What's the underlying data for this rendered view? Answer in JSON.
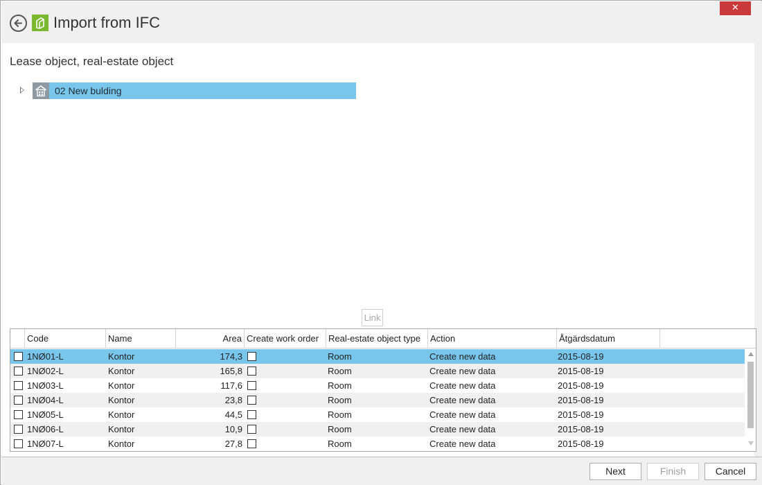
{
  "window": {
    "title": "Import from IFC",
    "close_label": "✕"
  },
  "section": {
    "title": "Lease object, real-estate object"
  },
  "tree": {
    "items": [
      {
        "label": "02 New bulding",
        "icon": "building-icon",
        "selected": true
      }
    ]
  },
  "link_button": {
    "label": "Link"
  },
  "grid": {
    "columns": [
      "Code",
      "Name",
      "Area",
      "Create work order",
      "Real-estate object type",
      "Action",
      "Åtgärdsdatum"
    ],
    "rows": [
      {
        "code": "1NØ01-L",
        "name": "Kontor",
        "area": "174,3",
        "type": "Room",
        "action": "Create new data",
        "date": "2015-08-19"
      },
      {
        "code": "1NØ02-L",
        "name": "Kontor",
        "area": "165,8",
        "type": "Room",
        "action": "Create new data",
        "date": "2015-08-19"
      },
      {
        "code": "1NØ03-L",
        "name": "Kontor",
        "area": "117,6",
        "type": "Room",
        "action": "Create new data",
        "date": "2015-08-19"
      },
      {
        "code": "1NØ04-L",
        "name": "Kontor",
        "area": "23,8",
        "type": "Room",
        "action": "Create new data",
        "date": "2015-08-19"
      },
      {
        "code": "1NØ05-L",
        "name": "Kontor",
        "area": "44,5",
        "type": "Room",
        "action": "Create new data",
        "date": "2015-08-19"
      },
      {
        "code": "1NØ06-L",
        "name": "Kontor",
        "area": "10,9",
        "type": "Room",
        "action": "Create new data",
        "date": "2015-08-19"
      },
      {
        "code": "1NØ07-L",
        "name": "Kontor",
        "area": "27,8",
        "type": "Room",
        "action": "Create new data",
        "date": "2015-08-19"
      }
    ]
  },
  "footer": {
    "next_label": "Next",
    "finish_label": "Finish",
    "cancel_label": "Cancel"
  },
  "colors": {
    "selection": "#79c6ec",
    "app_icon": "#7cb82f",
    "close_button": "#c9393a"
  }
}
